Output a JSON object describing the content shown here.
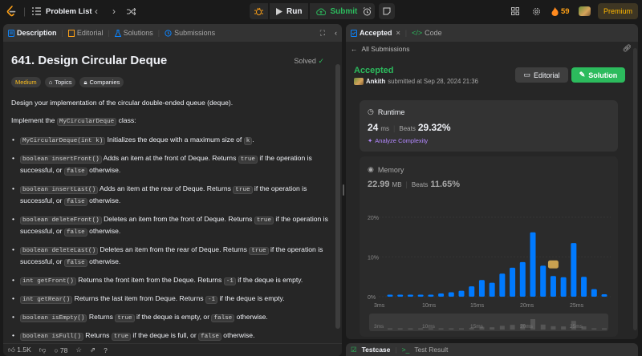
{
  "topbar": {
    "problem_list": "Problem List",
    "run": "Run",
    "submit": "Submit",
    "streak": "59",
    "premium": "Premium"
  },
  "left": {
    "tabs": [
      {
        "label": "Description"
      },
      {
        "label": "Editorial"
      },
      {
        "label": "Solutions"
      },
      {
        "label": "Submissions"
      }
    ],
    "title": "641. Design Circular Deque",
    "status": "Solved",
    "tags": {
      "difficulty": "Medium",
      "topics": "Topics",
      "companies": "Companies"
    },
    "intro": "Design your implementation of the circular double-ended queue (deque).",
    "implement_prefix": "Implement the ",
    "implement_code": "MyCircularDeque",
    "implement_suffix": " class:",
    "methods": [
      {
        "code": "MyCircularDeque(int k)",
        "text": " Initializes the deque with a maximum size of ",
        "code2": "k",
        "text2": "."
      },
      {
        "code": "boolean insertFront()",
        "text": " Adds an item at the front of Deque. Returns ",
        "code2": "true",
        "text2": " if the operation is successful, or ",
        "code3": "false",
        "text3": " otherwise."
      },
      {
        "code": "boolean insertLast()",
        "text": " Adds an item at the rear of Deque. Returns ",
        "code2": "true",
        "text2": " if the operation is successful, or ",
        "code3": "false",
        "text3": " otherwise."
      },
      {
        "code": "boolean deleteFront()",
        "text": " Deletes an item from the front of Deque. Returns ",
        "code2": "true",
        "text2": " if the operation is successful, or ",
        "code3": "false",
        "text3": " otherwise."
      },
      {
        "code": "boolean deleteLast()",
        "text": " Deletes an item from the rear of Deque. Returns ",
        "code2": "true",
        "text2": " if the operation is successful, or ",
        "code3": "false",
        "text3": " otherwise."
      },
      {
        "code": "int getFront()",
        "text": " Returns the front item from the Deque. Returns ",
        "code2": "-1",
        "text2": " if the deque is empty."
      },
      {
        "code": "int getRear()",
        "text": " Returns the last item from Deque. Returns ",
        "code2": "-1",
        "text2": " if the deque is empty."
      },
      {
        "code": "boolean isEmpty()",
        "text": " Returns ",
        "code2": "true",
        "text2": " if the deque is empty, or ",
        "code3": "false",
        "text3": " otherwise."
      },
      {
        "code": "boolean isFull()",
        "text": " Returns ",
        "code2": "true",
        "text2": " if the deque is full, or ",
        "code3": "false",
        "text3": " otherwise."
      }
    ],
    "footer": {
      "likes": "1.5K",
      "comments": "78"
    }
  },
  "right": {
    "tabs": [
      {
        "label": "Accepted"
      },
      {
        "label": "Code"
      }
    ],
    "back": "All Submissions",
    "result": "Accepted",
    "user": "Ankith",
    "submitted": "submitted at Sep 28, 2024 21:36",
    "editorial_btn": "Editorial",
    "solution_btn": "Solution",
    "runtime": {
      "label": "Runtime",
      "value": "24",
      "unit": "ms",
      "beats_label": "Beats",
      "beats": "29.32%",
      "analyze": "Analyze Complexity"
    },
    "memory": {
      "label": "Memory",
      "value": "22.99",
      "unit": "MB",
      "beats_label": "Beats",
      "beats": "11.65%"
    }
  },
  "bottom": {
    "testcase": "Testcase",
    "result": "Test Result"
  },
  "chart_data": {
    "type": "bar",
    "yticks": [
      "20%",
      "10%",
      "0%"
    ],
    "ylim": [
      0,
      20
    ],
    "xticks": [
      "3ms",
      "10ms",
      "15ms",
      "20ms",
      "25ms"
    ],
    "x": [
      3,
      5,
      7,
      9,
      11,
      13,
      15,
      17,
      19,
      20,
      21,
      23,
      25,
      27,
      29,
      31,
      33,
      35,
      37,
      39,
      41
    ],
    "values": [
      0.5,
      0.5,
      0.5,
      0.5,
      0.5,
      0.8,
      1.1,
      1.5,
      2.6,
      4.2,
      3.5,
      5.8,
      7.3,
      8.7,
      16.2,
      7.8,
      5.2,
      4.9,
      13.5,
      5.0,
      1.9,
      0.6
    ],
    "colors": {
      "bar": "#007aff",
      "grid": "#3e3e3e"
    }
  }
}
